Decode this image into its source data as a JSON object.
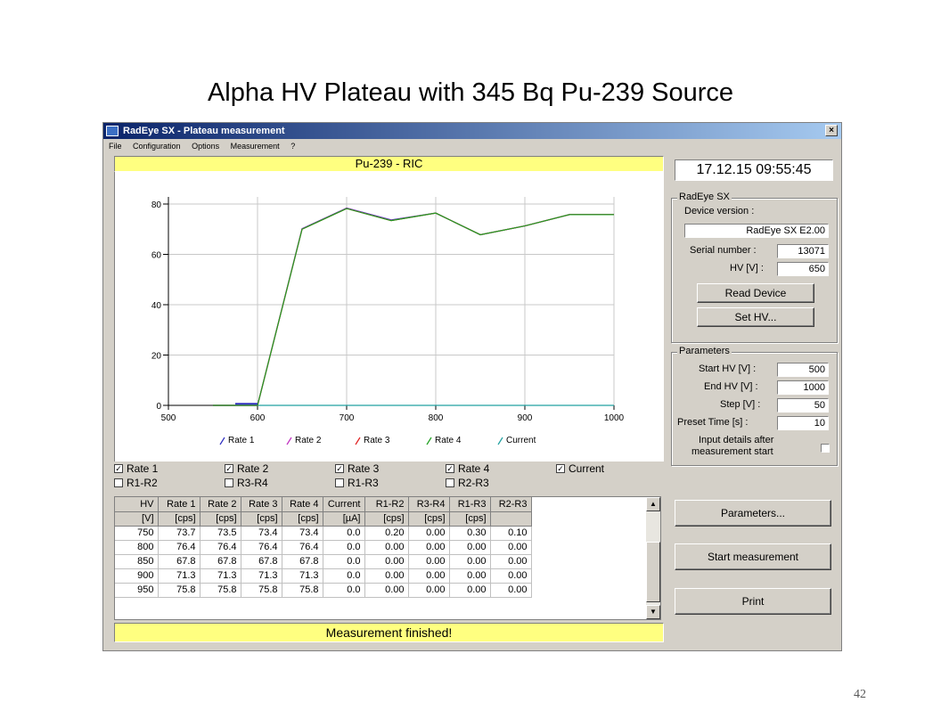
{
  "slide": {
    "title": "Alpha HV Plateau with 345 Bq Pu-239 Source",
    "page_number": "42"
  },
  "window": {
    "title": "RadEye SX - Plateau measurement",
    "menu": [
      "File",
      "Configuration",
      "Options",
      "Measurement",
      "?"
    ],
    "close_glyph": "×"
  },
  "chart_header": "Pu-239 - RIC",
  "datetime": "17.12.15   09:55:45",
  "device": {
    "group_label": "RadEye SX",
    "version_label": "Device version :",
    "version_value": "RadEye SX E2.00",
    "serial_label": "Serial number :",
    "serial_value": "13071",
    "hv_label": "HV [V] :",
    "hv_value": "650",
    "read_button": "Read Device",
    "set_hv_button": "Set HV..."
  },
  "parameters": {
    "group_label": "Parameters",
    "start_hv_label": "Start HV [V] :",
    "start_hv_value": "500",
    "end_hv_label": "End HV [V] :",
    "end_hv_value": "1000",
    "step_label": "Step [V] :",
    "step_value": "50",
    "preset_label": "Preset Time [s] :",
    "preset_value": "10",
    "input_details_line1": "Input details after",
    "input_details_line2": "measurement start"
  },
  "checkboxes": {
    "row1": [
      {
        "label": "Rate 1",
        "checked": true
      },
      {
        "label": "Rate 2",
        "checked": true
      },
      {
        "label": "Rate 3",
        "checked": true
      },
      {
        "label": "Rate 4",
        "checked": true
      },
      {
        "label": "Current",
        "checked": true
      }
    ],
    "row2": [
      {
        "label": "R1-R2",
        "checked": false
      },
      {
        "label": "R3-R4",
        "checked": false
      },
      {
        "label": "R1-R3",
        "checked": false
      },
      {
        "label": "R2-R3",
        "checked": false
      }
    ]
  },
  "table": {
    "headers": [
      "HV",
      "Rate 1",
      "Rate 2",
      "Rate 3",
      "Rate 4",
      "Current",
      "R1-R2",
      "R3-R4",
      "R1-R3",
      "R2-R3"
    ],
    "units": [
      "[V]",
      "[cps]",
      "[cps]",
      "[cps]",
      "[cps]",
      "[µA]",
      "[cps]",
      "[cps]",
      "[cps]",
      ""
    ],
    "rows": [
      [
        "750",
        "73.7",
        "73.5",
        "73.4",
        "73.4",
        "0.0",
        "0.20",
        "0.00",
        "0.30",
        "0.10"
      ],
      [
        "800",
        "76.4",
        "76.4",
        "76.4",
        "76.4",
        "0.0",
        "0.00",
        "0.00",
        "0.00",
        "0.00"
      ],
      [
        "850",
        "67.8",
        "67.8",
        "67.8",
        "67.8",
        "0.0",
        "0.00",
        "0.00",
        "0.00",
        "0.00"
      ],
      [
        "900",
        "71.3",
        "71.3",
        "71.3",
        "71.3",
        "0.0",
        "0.00",
        "0.00",
        "0.00",
        "0.00"
      ],
      [
        "950",
        "75.8",
        "75.8",
        "75.8",
        "75.8",
        "0.0",
        "0.00",
        "0.00",
        "0.00",
        "0.00"
      ]
    ]
  },
  "buttons": {
    "parameters": "Parameters...",
    "start": "Start measurement",
    "print": "Print"
  },
  "status": "Measurement finished!",
  "colors": {
    "rate1": "#3030c0",
    "rate2": "#c030c0",
    "rate3": "#e02020",
    "rate4": "#20a020",
    "current": "#20a0a0"
  },
  "chart_data": {
    "type": "line",
    "title": "",
    "xlabel": "",
    "ylabel": "",
    "xlim": [
      500,
      1000
    ],
    "ylim": [
      0,
      85
    ],
    "x_ticks": [
      500,
      600,
      700,
      800,
      900,
      1000
    ],
    "y_ticks": [
      0,
      20,
      40,
      60,
      80
    ],
    "grid": true,
    "legend_position": "bottom",
    "x": [
      550,
      575,
      600,
      650,
      700,
      750,
      800,
      850,
      900,
      950,
      1000
    ],
    "series": [
      {
        "name": "Rate 1",
        "values": [
          0,
          0,
          0,
          70.2,
          78.4,
          73.7,
          76.4,
          67.8,
          71.3,
          75.8,
          75.8
        ]
      },
      {
        "name": "Rate 2",
        "values": [
          0,
          0,
          0,
          70.1,
          78.3,
          73.5,
          76.4,
          67.8,
          71.3,
          75.8,
          75.8
        ]
      },
      {
        "name": "Rate 3",
        "values": [
          0,
          0,
          0,
          70.0,
          78.2,
          73.4,
          76.4,
          67.8,
          71.3,
          75.8,
          75.8
        ]
      },
      {
        "name": "Rate 4",
        "values": [
          0,
          0,
          0,
          70.0,
          78.2,
          73.4,
          76.4,
          67.8,
          71.3,
          75.8,
          75.8
        ]
      },
      {
        "name": "Current",
        "values": [
          0,
          0,
          0,
          0,
          0,
          0,
          0,
          0,
          0,
          0,
          0
        ]
      }
    ]
  }
}
